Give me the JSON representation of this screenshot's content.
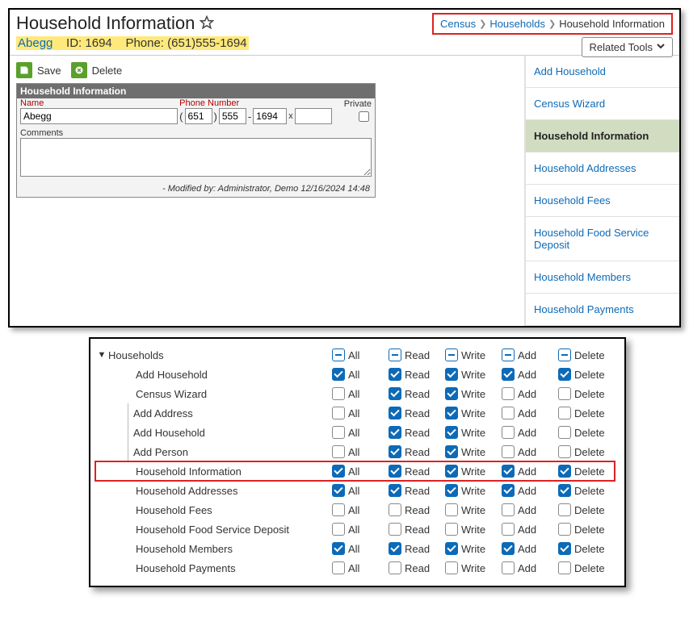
{
  "header": {
    "title": "Household Information",
    "breadcrumb": [
      "Census",
      "Households",
      "Household Information"
    ],
    "relatedTools": "Related Tools"
  },
  "record": {
    "name": "Abegg",
    "idLabel": "ID:",
    "id": "1694",
    "phoneLabel": "Phone:",
    "phoneDisplay": "(651)555-1694"
  },
  "buttons": {
    "save": "Save",
    "delete": "Delete"
  },
  "form": {
    "cardTitle": "Household Information",
    "labels": {
      "name": "Name",
      "phone": "Phone Number",
      "private": "Private",
      "comments": "Comments"
    },
    "values": {
      "name": "Abegg",
      "phone1": "651",
      "phone2": "555",
      "phone3": "1694",
      "ext": "",
      "comments": ""
    },
    "modified": "- Modified by: Administrator, Demo 12/16/2024 14:48"
  },
  "nav": [
    {
      "label": "Add Household",
      "active": false
    },
    {
      "label": "Census Wizard",
      "active": false
    },
    {
      "label": "Household Information",
      "active": true
    },
    {
      "label": "Household Addresses",
      "active": false
    },
    {
      "label": "Household Fees",
      "active": false
    },
    {
      "label": "Household Food Service Deposit",
      "active": false
    },
    {
      "label": "Household Members",
      "active": false
    },
    {
      "label": "Household Payments",
      "active": false
    }
  ],
  "permCols": [
    "All",
    "Read",
    "Write",
    "Add",
    "Delete"
  ],
  "permRows": [
    {
      "label": "Households",
      "indent": 1,
      "caret": true,
      "state": [
        "minus",
        "minus",
        "minus",
        "minus",
        "minus"
      ],
      "hl": false
    },
    {
      "label": "Add Household",
      "indent": 2,
      "state": [
        "checked",
        "checked",
        "checked",
        "checked",
        "checked"
      ],
      "hl": false
    },
    {
      "label": "Census Wizard",
      "indent": 2,
      "state": [
        "empty",
        "checked",
        "checked",
        "empty",
        "empty"
      ],
      "hl": false
    },
    {
      "label": "Add Address",
      "indent": 3,
      "state": [
        "empty",
        "checked",
        "checked",
        "empty",
        "empty"
      ],
      "hl": false
    },
    {
      "label": "Add Household",
      "indent": 3,
      "state": [
        "empty",
        "checked",
        "checked",
        "empty",
        "empty"
      ],
      "hl": false
    },
    {
      "label": "Add Person",
      "indent": 3,
      "state": [
        "empty",
        "checked",
        "checked",
        "empty",
        "empty"
      ],
      "hl": false
    },
    {
      "label": "Household Information",
      "indent": 2,
      "state": [
        "checked",
        "checked",
        "checked",
        "checked",
        "checked"
      ],
      "hl": true
    },
    {
      "label": "Household Addresses",
      "indent": 2,
      "state": [
        "checked",
        "checked",
        "checked",
        "checked",
        "checked"
      ],
      "hl": false
    },
    {
      "label": "Household Fees",
      "indent": 2,
      "state": [
        "empty",
        "empty",
        "empty",
        "empty",
        "empty"
      ],
      "hl": false
    },
    {
      "label": "Household Food Service Deposit",
      "indent": 2,
      "state": [
        "empty",
        "empty",
        "empty",
        "empty",
        "empty"
      ],
      "hl": false
    },
    {
      "label": "Household Members",
      "indent": 2,
      "state": [
        "checked",
        "checked",
        "checked",
        "checked",
        "checked"
      ],
      "hl": false
    },
    {
      "label": "Household Payments",
      "indent": 2,
      "state": [
        "empty",
        "empty",
        "empty",
        "empty",
        "empty"
      ],
      "hl": false
    }
  ]
}
